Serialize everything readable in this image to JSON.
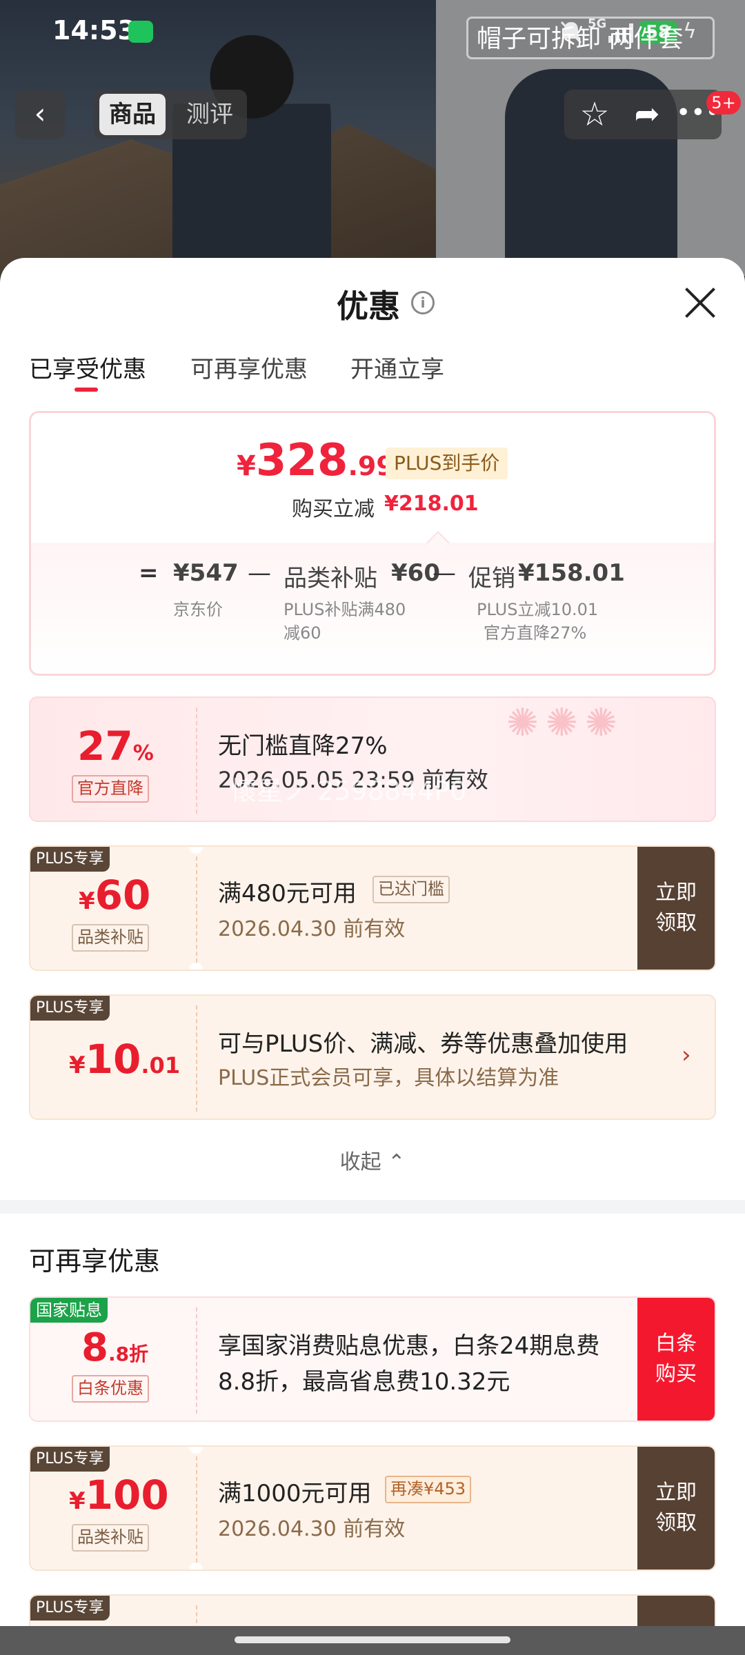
{
  "status": {
    "time": "14:53",
    "network": "5G",
    "battery": "58"
  },
  "header": {
    "product_title": "帽子可拆卸  两件套",
    "tab_product": "商品",
    "tab_review": "测评",
    "cart_badge": "5+"
  },
  "sheet": {
    "title": "优惠",
    "tabs": [
      "已享受优惠",
      "可再享优惠",
      "开通立享"
    ]
  },
  "summary": {
    "yen": "¥",
    "price_int": "328",
    "price_dec": ".99",
    "price_tag": "PLUS到手价",
    "reduce_label": "购买立减",
    "reduce_value": "¥218.01",
    "eq": "=",
    "minus": "—",
    "jd_price": "¥547",
    "jd_price_label": "京东价",
    "category_label": "品类补贴",
    "category_value": "¥60",
    "category_note": "PLUS补贴满480减60",
    "promo_label": "促销",
    "promo_value": "¥158.01",
    "promo_note1": "PLUS立减10.01",
    "promo_note2": "官方直降27%"
  },
  "coupons": [
    {
      "big": "27",
      "unit": "%",
      "box": "官方直降",
      "title": "无门槛直降27%",
      "sub": "2026.05.05 23:59 前有效",
      "watermark": "懷星ノ 2598844P0"
    },
    {
      "tag": "PLUS专享",
      "yen": "¥",
      "big": "60",
      "box": "品类补贴",
      "title": "满480元可用",
      "badge": "已达门槛",
      "sub": "2026.04.30 前有效",
      "btn": "立即\n领取"
    },
    {
      "tag": "PLUS专享",
      "yen": "¥",
      "big": "10",
      "dec": ".01",
      "title": "可与PLUS价、满减、券等优惠叠加使用",
      "sub": "PLUS正式会员可享，具体以结算为准"
    }
  ],
  "collapse_label": "收起",
  "more_section": {
    "title": "可再享优惠",
    "items": [
      {
        "tag": "国家贴息",
        "big": "8",
        "dec": ".8折",
        "box": "白条优惠",
        "title": "享国家消费贴息优惠，白条24期息费",
        "title2": "8.8折，最高省息费10.32元",
        "btn": "白条\n购买"
      },
      {
        "tag": "PLUS专享",
        "yen": "¥",
        "big": "100",
        "box": "品类补贴",
        "title": "满1000元可用",
        "badge": "再凑¥453",
        "sub": "2026.04.30 前有效",
        "btn": "立即\n领取"
      },
      {
        "tag": "PLUS专享"
      }
    ]
  },
  "colors": {
    "accent": "#f0233c",
    "plus_brown": "#574133",
    "green": "#1ca34a"
  }
}
